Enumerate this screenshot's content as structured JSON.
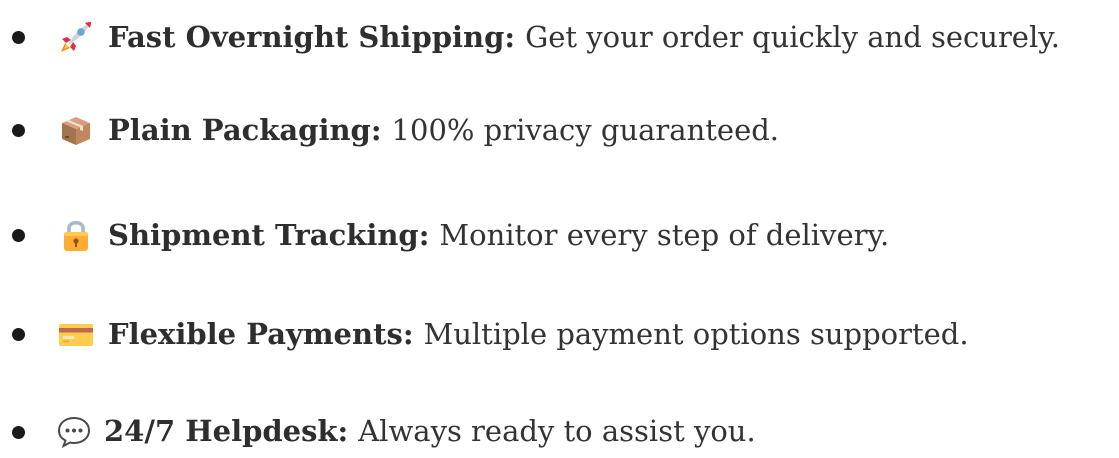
{
  "features": [
    {
      "icon": "rocket-icon",
      "title": "Fast Overnight Shipping:",
      "description": "Get your order quickly and securely."
    },
    {
      "icon": "package-icon",
      "title": "Plain Packaging:",
      "description": "100% privacy guaranteed."
    },
    {
      "icon": "lock-icon",
      "title": "Shipment Tracking:",
      "description": "Monitor every step of delivery."
    },
    {
      "icon": "credit-card-icon",
      "title": "Flexible Payments:",
      "description": "Multiple payment options supported."
    },
    {
      "icon": "speech-bubble-icon",
      "title": "24/7 Helpdesk:",
      "description": "Always ready to assist you."
    }
  ],
  "colors": {
    "text": "#333333",
    "bullet": "#1a1a1a",
    "background": "#ffffff"
  }
}
